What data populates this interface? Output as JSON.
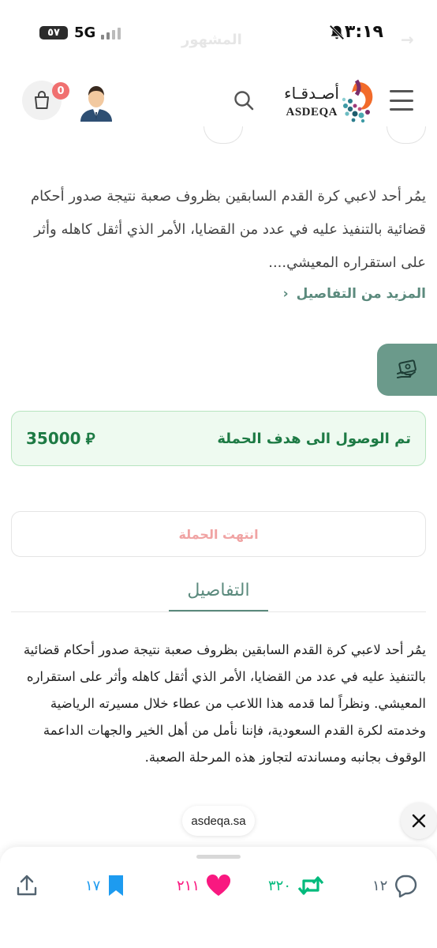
{
  "status_bar": {
    "time": "٣:١٩",
    "battery": "٥٧",
    "network": "5G",
    "faded_title": "المشهور"
  },
  "header": {
    "logo_ar": "أصـدقـاء",
    "logo_en": "ASDEQA",
    "cart_count": "0"
  },
  "summary": {
    "text": "يمُر أحد لاعبي كرة القدم السابقين بظروف صعبة نتيجة صدور أحكام قضائية بالتنفيذ عليه في عدد من القضايا، الأمر الذي أثقل كاهله وأثر على استقراره المعيشي....",
    "more_label": "المزيد من التفاصيل",
    "more_chevron": "‹"
  },
  "campaign": {
    "goal_text": "تم الوصول الى هدف الحملة",
    "goal_amount": "35000",
    "currency_symbol": "⃁",
    "ended_label": "انتهت الحملة"
  },
  "details": {
    "tab_label": "التفاصيل",
    "body": "يمُر أحد لاعبي كرة القدم السابقين بظروف صعبة نتيجة صدور أحكام قضائية بالتنفيذ عليه في عدد من القضايا، الأمر الذي أثقل كاهله وأثر على استقراره المعيشي. ونظراً لما قدمه هذا اللاعب من عطاء خلال مسيرته الرياضية وخدمته لكرة القدم السعودية، فإننا نأمل من أهل الخير والجهات الداعمة الوقوف بجانبه ومساندته لتجاوز هذه المرحلة الصعبة."
  },
  "browser": {
    "url": "asdeqa.sa"
  },
  "social_actions": {
    "replies": "١٢",
    "reposts": "٣٢٠",
    "likes": "٢١١",
    "bookmarks": "١٧"
  },
  "colors": {
    "accent": "#5b8a7d",
    "goal_green": "#1d7a44",
    "goal_bg": "#eefaf0",
    "like_pink": "#f91880",
    "repost_green": "#00ba7c",
    "bookmark_blue": "#1d9bf0",
    "badge_red": "#f07070"
  },
  "icons": [
    "bell-off-icon",
    "battery-icon",
    "signal-icon",
    "menu-icon",
    "search-icon",
    "avatar-icon",
    "cart-icon",
    "donate-icon",
    "close-icon",
    "share-icon",
    "bookmark-icon",
    "heart-icon",
    "repost-icon",
    "reply-icon"
  ]
}
